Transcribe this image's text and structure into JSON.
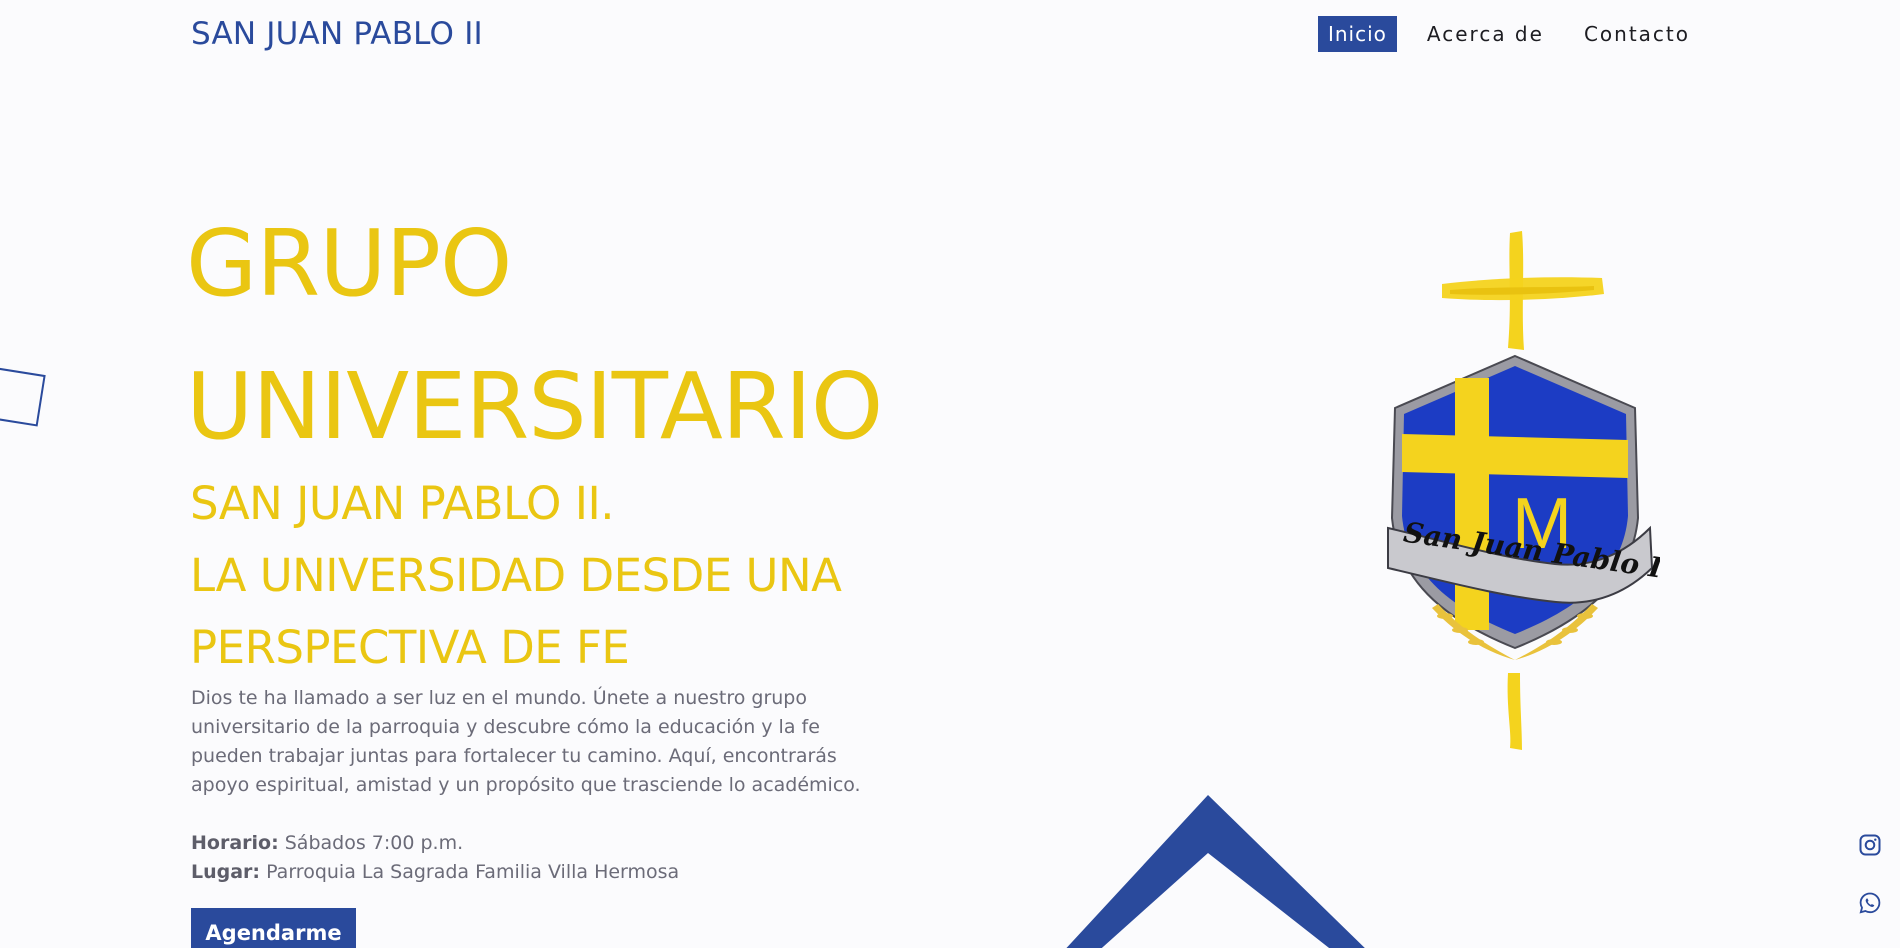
{
  "header": {
    "brand": "SAN JUAN PABLO II",
    "nav": [
      {
        "label": "Inicio",
        "active": true
      },
      {
        "label": "Acerca de",
        "active": false
      },
      {
        "label": "Contacto",
        "active": false
      }
    ]
  },
  "hero": {
    "title_line1": "GRUPO",
    "title_line2": "UNIVERSITARIO",
    "subtitle_line1": "SAN JUAN PABLO II.",
    "subtitle_line2": "LA UNIVERSIDAD DESDE UNA",
    "subtitle_line3": "PERSPECTIVA DE FE",
    "description": "Dios te ha llamado a ser luz en el mundo. Únete a nuestro grupo universitario de la parroquia y descubre cómo la educación y la fe pueden trabajar juntas para fortalecer tu camino. Aquí, encontrarás apoyo espiritual, amistad y un propósito que trasciende lo académico.",
    "schedule_label": "Horario:",
    "schedule_value": "Sábados 7:00 p.m.",
    "place_label": "Lugar:",
    "place_value": "Parroquia La Sagrada Familia Villa Hermosa",
    "cta_label": "Agendarme"
  },
  "emblem": {
    "banner_text": "San Juan Pablo II",
    "letter": "M"
  },
  "social": {
    "icons": [
      "instagram-icon",
      "whatsapp-icon"
    ]
  },
  "colors": {
    "primary_blue": "#2a4a9c",
    "accent_yellow": "#eac612",
    "background": "#fbfbfd",
    "text_gray": "#6b6b78"
  }
}
